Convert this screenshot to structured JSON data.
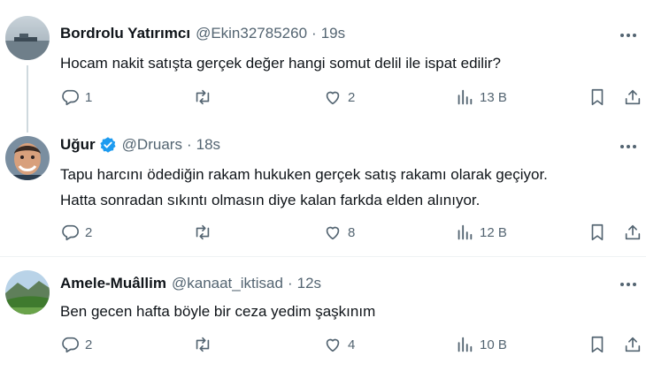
{
  "tweets": [
    {
      "name": "Bordrolu Yatırımcı",
      "handle": "@Ekin32785260",
      "separator": "·",
      "time": "19s",
      "text": "Hocam nakit satışta gerçek değer hangi somut delil ile ispat edilir?",
      "replies": "1",
      "retweets": "",
      "likes": "2",
      "views": "13 B",
      "verified": false
    },
    {
      "name": "Uğur",
      "handle": "@Druars",
      "separator": "·",
      "time": "18s",
      "text_line1": "Tapu harcını ödediğin rakam hukuken gerçek satış rakamı olarak geçiyor.",
      "text_line2": "Hatta sonradan sıkıntı olmasın diye kalan farkda elden alınıyor.",
      "replies": "2",
      "retweets": "",
      "likes": "8",
      "views": "12 B",
      "verified": true
    },
    {
      "name": "Amele-Muâllim",
      "handle": "@kanaat_iktisad",
      "separator": "·",
      "time": "12s",
      "text": "Ben gecen hafta böyle bir ceza yedim şaşkınım",
      "replies": "2",
      "retweets": "",
      "likes": "4",
      "views": "10 B",
      "verified": false
    }
  ],
  "icons": {
    "reply": "reply-icon",
    "retweet": "retweet-icon",
    "like": "heart-icon",
    "views": "views-chart-icon",
    "bookmark": "bookmark-icon",
    "share": "share-icon",
    "more": "more-dots-icon",
    "verified": "verified-badge-icon"
  },
  "colors": {
    "text": "#0f1419",
    "secondary": "#536471",
    "verified": "#1d9bf0",
    "divider": "#eff3f4",
    "thread_line": "#cfd9de"
  }
}
